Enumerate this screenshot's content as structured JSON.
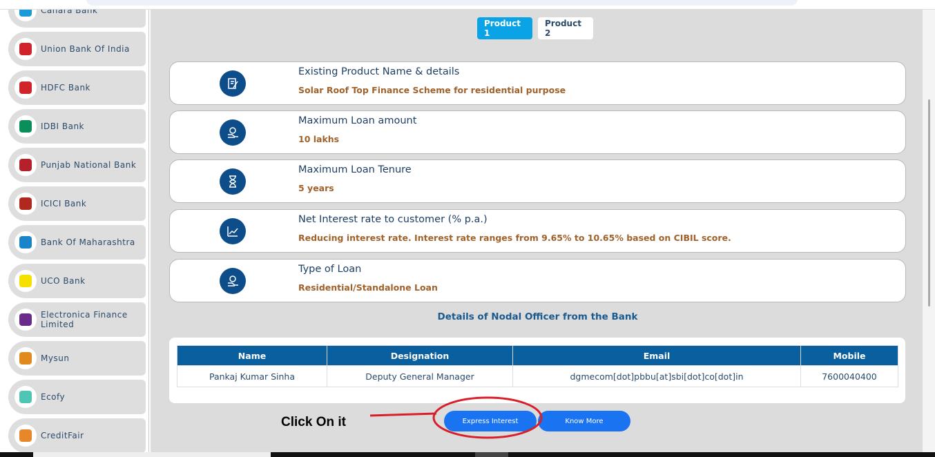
{
  "sidebar": {
    "banks": [
      {
        "name": "Canara Bank",
        "logo": "canara-logo",
        "logo_color": "#1a9ad6"
      },
      {
        "name": "Union Bank Of India",
        "logo": "union-bank-logo",
        "logo_color": "#d0232a"
      },
      {
        "name": "HDFC Bank",
        "logo": "hdfc-logo",
        "logo_color": "#d0232a"
      },
      {
        "name": "IDBI Bank",
        "logo": "idbi-logo",
        "logo_color": "#0a8f5a"
      },
      {
        "name": "Punjab National Bank",
        "logo": "pnb-logo",
        "logo_color": "#b5212b"
      },
      {
        "name": "ICICI Bank",
        "logo": "icici-logo",
        "logo_color": "#b0281e"
      },
      {
        "name": "Bank Of Maharashtra",
        "logo": "bom-logo",
        "logo_color": "#1a84c8"
      },
      {
        "name": "UCO Bank",
        "logo": "uco-logo",
        "logo_color": "#f5e000"
      },
      {
        "name": "Electronica Finance Limited",
        "logo": "efl-logo",
        "logo_color": "#6a2a8a"
      },
      {
        "name": "Mysun",
        "logo": "mysun-logo",
        "logo_color": "#e08a1e"
      },
      {
        "name": "Ecofy",
        "logo": "ecofy-logo",
        "logo_color": "#4fc6b4"
      },
      {
        "name": "CreditFair",
        "logo": "creditfair-logo",
        "logo_color": "#e8862a"
      }
    ]
  },
  "tabs": [
    {
      "label": "Product 1",
      "active": true
    },
    {
      "label": "Product 2",
      "active": false
    }
  ],
  "details": [
    {
      "title": "Existing Product Name & details",
      "value": "Solar Roof Top Finance Scheme for residential purpose",
      "icon": "document-edit-icon"
    },
    {
      "title": "Maximum Loan amount",
      "value": "10 lakhs",
      "icon": "money-hand-icon"
    },
    {
      "title": "Maximum Loan Tenure",
      "value": "5 years",
      "icon": "hourglass-icon"
    },
    {
      "title": "Net Interest rate to customer (% p.a.)",
      "value": "Reducing interest rate. Interest rate ranges from 9.65% to 10.65% based on CIBIL score.",
      "icon": "interest-chart-icon"
    },
    {
      "title": "Type of Loan",
      "value": "Residential/Standalone Loan",
      "icon": "money-hand-icon"
    }
  ],
  "nodal": {
    "heading": "Details of Nodal Officer from the Bank",
    "columns": [
      "Name",
      "Designation",
      "Email",
      "Mobile"
    ],
    "rows": [
      [
        "Pankaj Kumar Sinha",
        "Deputy General Manager",
        "dgmecom[dot]pbbu[at]sbi[dot]co[dot]in",
        "7600040400"
      ]
    ]
  },
  "actions": {
    "express": "Express Interest",
    "know_more": "Know More"
  },
  "annotation": {
    "text": "Click On it",
    "color": "#d8202a"
  },
  "colors": {
    "accent": "#0aa3e6",
    "button": "#1a73f0",
    "header": "#0a5f9e",
    "value": "#a0622a"
  }
}
